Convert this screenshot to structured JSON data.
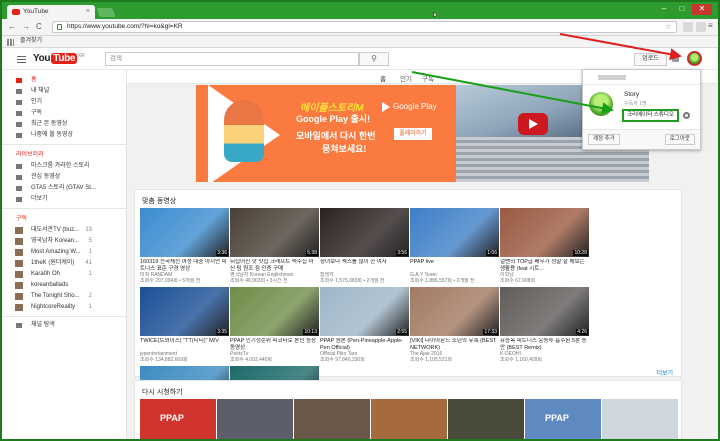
{
  "browser": {
    "tab_title": "YouTube",
    "tab_close": "×",
    "url": "https://www.youtube.com/?hl=ko&gl=KR",
    "bookmarks_label": "즐겨찾기",
    "back": "←",
    "forward": "→",
    "reload": "C",
    "minimize": "–",
    "maximize": "□",
    "close": "✕"
  },
  "masthead": {
    "logo_you": "You",
    "logo_tube": "Tube",
    "logo_region": "KR",
    "search_placeholder": "검색",
    "upload_label": "업로드"
  },
  "sidebar": {
    "main_items": [
      {
        "label": "홈",
        "active": true,
        "icon": "home-icon"
      },
      {
        "label": "내 채널",
        "icon": "channel-icon"
      },
      {
        "label": "인기",
        "icon": "fire-icon"
      },
      {
        "label": "구독",
        "icon": "subscriptions-icon"
      },
      {
        "label": "최근 본 동영상",
        "icon": "history-icon"
      },
      {
        "label": "나중에 볼 동영상",
        "icon": "watch-later-icon"
      }
    ],
    "library_heading": "라이브러리",
    "library_items": [
      {
        "label": "마스크룸 카라한 스토리",
        "icon": "playlist-icon"
      },
      {
        "label": "관심 동영상",
        "icon": "like-icon"
      },
      {
        "label": "GTA5 스토리 (GTAV St...",
        "icon": "playlist-icon"
      },
      {
        "label": "더보기",
        "icon": "chevron-down-icon"
      }
    ],
    "subs_heading": "구독",
    "subs_items": [
      {
        "label": "대도서관TV (buz...",
        "count": "13"
      },
      {
        "label": "영국남자 Korean...",
        "count": "5"
      },
      {
        "label": "Most Amazing W...",
        "count": "1"
      },
      {
        "label": "1theK (원더케이)",
        "count": "41"
      },
      {
        "label": "Kara0h Oh",
        "count": "1"
      },
      {
        "label": "koreanballads",
        "count": ""
      },
      {
        "label": "The Tonight Sho...",
        "count": "2"
      },
      {
        "label": "NightcoreReality",
        "count": "1"
      }
    ],
    "footer_item": "채널 탐색"
  },
  "main": {
    "tabs": [
      "홈",
      "인기",
      "구독"
    ],
    "banner": {
      "brand": "메이플스토리M",
      "headline_tail": "Google Play 출시!",
      "line2": "모바일에서 다시 한번",
      "line3": "뭉쳐보세요!",
      "store_label": "Google Play",
      "cta": "플레이하기"
    },
    "recommended_title": "맞춤 동영상",
    "more_label": "더보기",
    "videos": [
      {
        "title": "160319 전국체전 여성 대중 아시안 피트니스 표준 구경 영상",
        "channel": "미쳐 RANDAM",
        "views": "조회수 297,094회 • 5개월 전",
        "duration": "3:36",
        "bg": "#3b8ccf"
      },
      {
        "title": "뒤집어진 핫 맛집 크래프트 맥주집 마신 팀 원조 짐 인증 구매",
        "channel": "영국남자 Korean Englishman",
        "views": "조회수 46,903회 • 3시간 전",
        "duration": "5:38",
        "bg": "#4a4036"
      },
      {
        "title": "창녀보다 섹스를 많이 한 여자",
        "channel": "잡생각",
        "views": "조회수 1,575,083회 • 2개월 전",
        "duration": "3:56",
        "bg": "#2b2121"
      },
      {
        "title": "PPAP live",
        "channel": "G.A.Y Team",
        "views": "조회수 1,886,557회 • 2개월 전",
        "duration": "1:06",
        "bg": "#3f7fc7"
      },
      {
        "title": "걸밴의 TOP급 배우가 정말 잘 해보는 생활용 (feat 시트...",
        "channel": "이외남",
        "views": "조회수 67,908회",
        "duration": "10:28",
        "bg": "#9a5a42"
      },
      {
        "title": "TWICE(트와이스) \"TT(티티)\" M/V",
        "channel": "jypentertainment",
        "views": "조회수 134,882,669회",
        "duration": "3:35",
        "bg": "#1b4f96"
      },
      {
        "title": "PPAP 인기정순위 피코타로 본인 등장 동영상",
        "channel": "PeetsTv",
        "views": "조회수 4,093,440회",
        "duration": "10:13",
        "bg": "#6f8d49"
      },
      {
        "title": "PPAP 원본 (Pen-Pineapple-Apple-Pen Official)",
        "channel": "Official Piko Taro",
        "views": "조회수 97,840,330회",
        "duration": "2:55",
        "bg": "#9fb6c8"
      },
      {
        "title": "[VIKI] 다이아몬드 소년의 유혹 (BEST NETWORK)",
        "channel": "The Ajae 2016",
        "views": "조회수 1,105,521회",
        "duration": "17:33",
        "bg": "#a27a62"
      },
      {
        "title": "유승옥 피트니스 운동투 흡수된 5분 동안 (BEST Remix)",
        "channel": "K-DEOHI",
        "views": "조회수 1,160,409회",
        "duration": "4:26",
        "bg": "#5f5c5a"
      },
      {
        "title": "11살짜리 소녀 기적 영상 세계적인 포대",
        "channel": "블루클레이스",
        "views": "조회수 863,190회",
        "duration": "1:00",
        "bg": "#3c8cc1"
      },
      {
        "title": "배병호범 테니스 콘솔 활동 하는 고급 세계최고의",
        "channel": "모아지빠",
        "views": "조회수 3,045,447회",
        "duration": "4:30",
        "bg": "#1c6a6a"
      }
    ],
    "rewatch_title": "다시 시청하기",
    "rewatch": [
      {
        "label": "PPAP",
        "bg": "#d0342c"
      },
      {
        "label": "",
        "bg": "#5c5e6a"
      },
      {
        "label": "",
        "bg": "#6c5848"
      },
      {
        "label": "",
        "bg": "#a56a40"
      },
      {
        "label": "",
        "bg": "#4a4a3a"
      },
      {
        "label": "PPAP",
        "bg": "#5e8ac1"
      },
      {
        "label": "",
        "bg": "#cfd7de"
      }
    ]
  },
  "account_popup": {
    "channel_name": "Story",
    "subscribers": "구독자 1명",
    "studio_button": "크리에이터 스튜디오",
    "add_account": "계정 추가",
    "sign_out": "로그아웃"
  }
}
